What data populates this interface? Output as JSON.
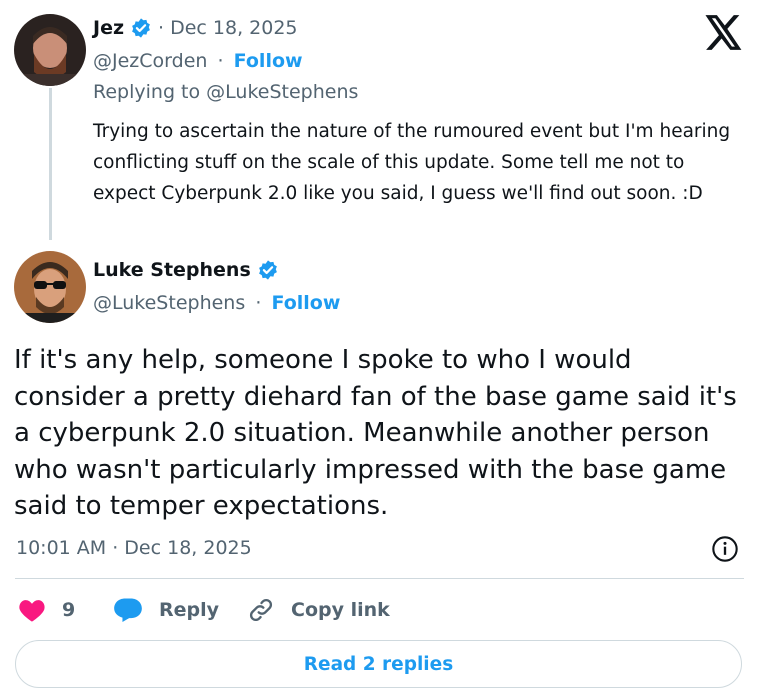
{
  "reply_tweet": {
    "author_name": "Jez",
    "separator_date": "· Dec 18, 2025",
    "handle": "@JezCorden",
    "dot": "·",
    "follow_label": "Follow",
    "replying_to": "Replying to @LukeStephens",
    "text": "Trying to ascertain the nature of the rumoured event but I'm hearing conflicting stuff on the scale of this update. Some tell me not to expect Cyberpunk 2.0 like you said, I guess we'll find out soon. :D"
  },
  "main_tweet": {
    "author_name": "Luke Stephens",
    "handle": "@LukeStephens",
    "dot": "·",
    "follow_label": "Follow",
    "text": "If it's any help, someone I spoke to who I would consider a pretty diehard fan of the base game said it's a cyberpunk 2.0 situation. Meanwhile another person who wasn't particularly impressed with the base game said to temper expectations.",
    "timestamp": "10:01 AM · Dec 18, 2025"
  },
  "actions": {
    "like_count": "9",
    "reply_label": "Reply",
    "copy_link_label": "Copy link"
  },
  "read_replies_label": "Read 2 replies",
  "colors": {
    "accent": "#1d9bf0",
    "like": "#f91880",
    "text": "#0f1419",
    "muted": "#536471",
    "border": "#cfd9de"
  },
  "icons": [
    "verified-badge-icon",
    "x-logo-icon",
    "info-icon",
    "heart-icon",
    "reply-bubble-icon",
    "link-icon"
  ]
}
